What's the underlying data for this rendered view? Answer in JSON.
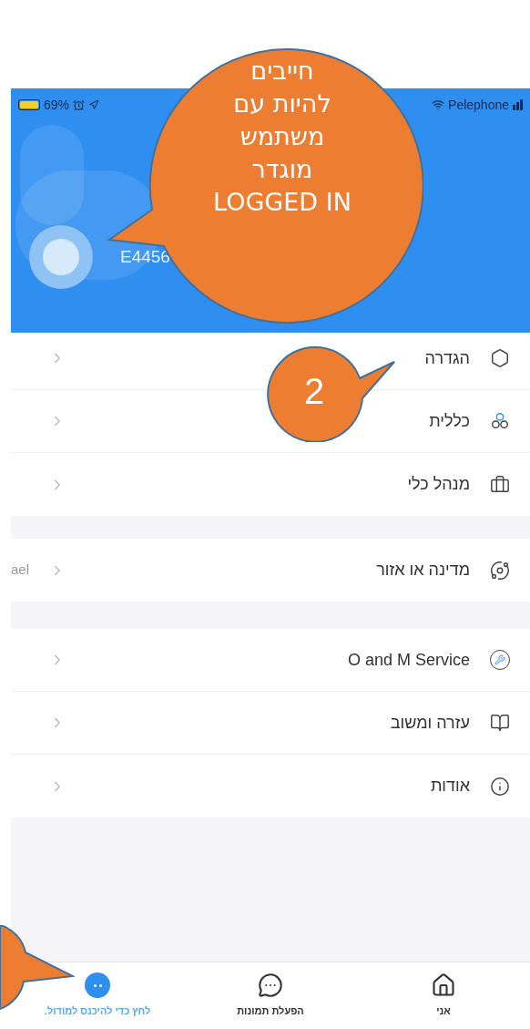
{
  "status_bar": {
    "battery": "69%",
    "carrier": "Pelephone"
  },
  "profile": {
    "name": "E4456"
  },
  "groups": [
    {
      "items": [
        {
          "label": "הגדרה"
        },
        {
          "label": "כללית"
        },
        {
          "label": "מנהל כלי"
        }
      ]
    },
    {
      "items": [
        {
          "label": "מדינה או אזור",
          "value": "ael"
        }
      ]
    },
    {
      "items": [
        {
          "label": "O and M Service"
        },
        {
          "label": "עזרה ומשוב"
        },
        {
          "label": "אודות"
        }
      ]
    }
  ],
  "tabs": [
    {
      "label": "אני",
      "selected": false
    },
    {
      "label": "הפעלת תמונות",
      "selected": false
    },
    {
      "label": "לחץ כדי להיכנס למודול.",
      "selected": true
    }
  ],
  "callouts": [
    {
      "kind": "large",
      "lines": [
        "חייבים",
        "להיות עם",
        "משתמש",
        "מוגדר",
        "LOGGED IN"
      ]
    },
    {
      "kind": "small",
      "lines": [
        "2"
      ]
    },
    {
      "kind": "edge"
    }
  ]
}
